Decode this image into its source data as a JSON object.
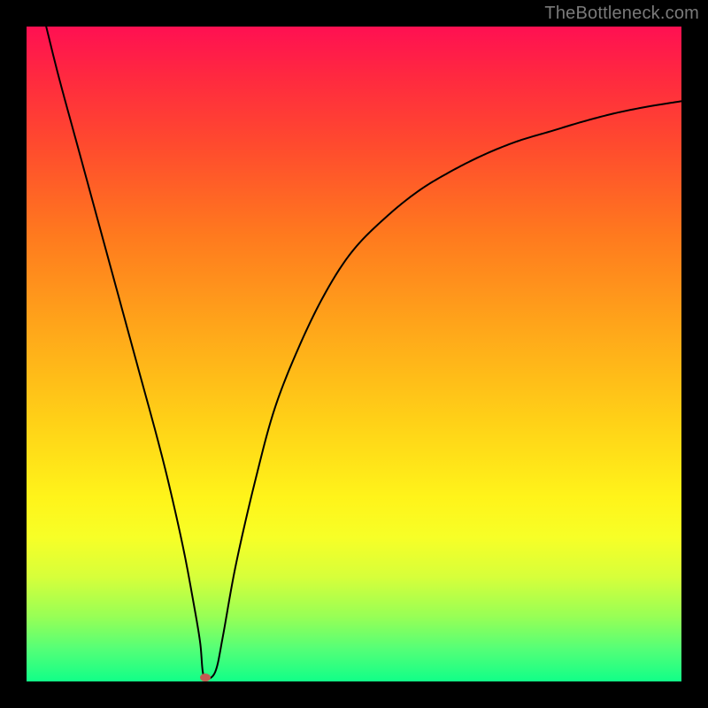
{
  "attribution": "TheBottleneck.com",
  "chart_data": {
    "type": "line",
    "title": "",
    "xlabel": "",
    "ylabel": "",
    "xlim": [
      0,
      100
    ],
    "ylim": [
      0,
      100
    ],
    "x": [
      3,
      5,
      8,
      11,
      14,
      17,
      20,
      22,
      24,
      25.5,
      26.5,
      27,
      28,
      29,
      30,
      32,
      35,
      38,
      42,
      46,
      50,
      55,
      60,
      65,
      70,
      75,
      80,
      85,
      90,
      95,
      100
    ],
    "values": [
      100,
      92,
      81,
      70,
      59,
      48,
      37,
      29,
      20,
      12,
      6,
      1,
      0.5,
      2,
      7,
      18,
      31,
      42,
      52,
      60,
      66,
      71,
      75,
      78,
      80.5,
      82.5,
      84,
      85.5,
      86.8,
      87.8,
      88.6
    ],
    "marker": {
      "x": 27.3,
      "y": 0.6,
      "color": "#c25a52",
      "rx": 6,
      "ry": 4.5
    },
    "background_gradient": {
      "top": "#ff1052",
      "mid": "#ffd017",
      "bottom": "#11ff88"
    }
  }
}
